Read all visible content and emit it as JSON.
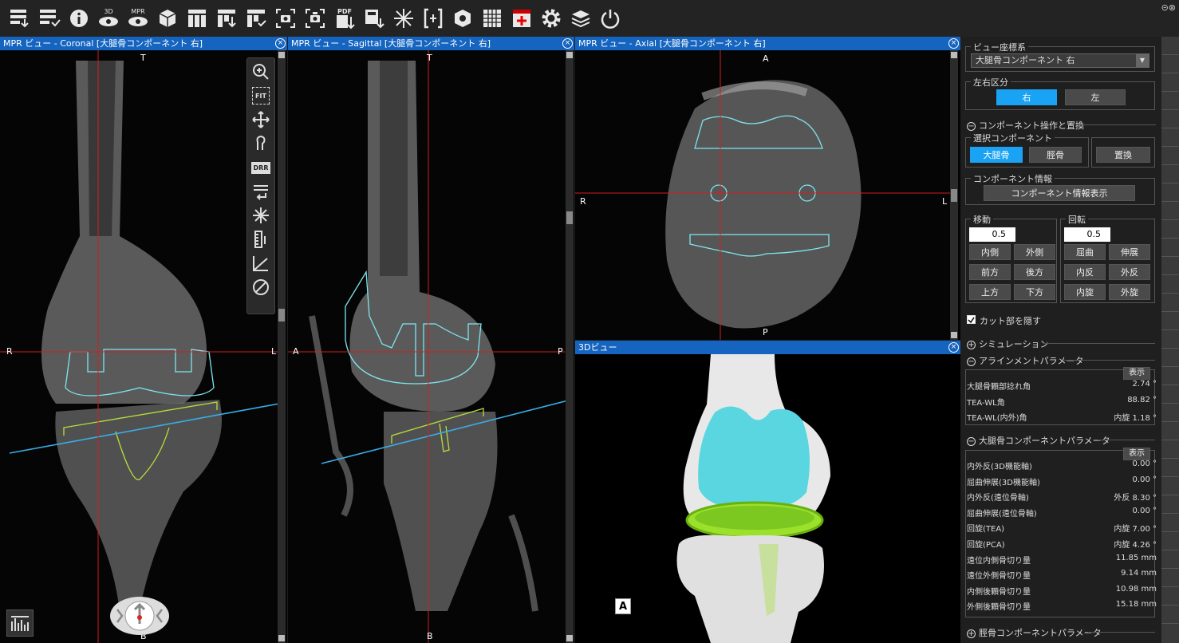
{
  "window": {
    "controls": "⊝⊗"
  },
  "toolbar": {
    "icons": [
      "load-case-icon",
      "save-case-icon",
      "info-icon",
      "3d-view-icon",
      "mpr-view-icon",
      "implant-cube-icon",
      "layout-icon",
      "export-layout-icon",
      "save-layout-icon",
      "screenshot-icon",
      "screenshot-all-icon",
      "pdf-export-icon",
      "snapshot-icon",
      "crosshair-icon",
      "bracket-icon",
      "component-icon",
      "grid-icon",
      "marker-icon",
      "settings-icon",
      "layers-icon",
      "power-icon"
    ],
    "labels": {
      "3d": "3D",
      "mpr": "MPR",
      "pdf": "PDF"
    }
  },
  "views": {
    "coronal": {
      "title": "MPR ビュー - Coronal [大腿骨コンポーネント 右]",
      "top": "T",
      "bottom": "B",
      "left": "R",
      "right": "L"
    },
    "sagittal": {
      "title": "MPR ビュー - Sagittal [大腿骨コンポーネント 右]",
      "top": "T",
      "bottom": "B",
      "left": "A",
      "right": "P"
    },
    "axial": {
      "title": "MPR ビュー - Axial [大腿骨コンポーネント 右]",
      "top": "A",
      "bottom": "P",
      "left": "R",
      "right": "L"
    },
    "v3d": {
      "title": "3Dビュー",
      "orient": "A"
    }
  },
  "viewtools": {
    "fit": "FIT",
    "drr": "DRR"
  },
  "panel": {
    "coord_title": "ビュー座標系",
    "coord_value": "大腿骨コンポーネント 右",
    "side_title": "左右区分",
    "side_right": "右",
    "side_left": "左",
    "comp_section": "コンポーネント操作と置換",
    "sel_title": "選択コンポーネント",
    "femur": "大腿骨",
    "tibia": "脛骨",
    "replace": "置換",
    "info_title": "コンポーネント情報",
    "info_btn": "コンポーネント情報表示",
    "move_title": "移動",
    "rot_title": "回転",
    "move_val": "0.5",
    "rot_val": "0.5",
    "move_btns": [
      "内側",
      "外側",
      "前方",
      "後方",
      "上方",
      "下方"
    ],
    "rot_btns": [
      "屈曲",
      "伸展",
      "内反",
      "外反",
      "内旋",
      "外旋"
    ],
    "hide_cut": "カット部を隠す",
    "simulation": "シミュレーション",
    "align_title": "アラインメントパラメータ",
    "show": "表示",
    "align_rows": [
      {
        "k": "大腿骨顆部捻れ角",
        "v": "2.74 °"
      },
      {
        "k": "TEA-WL角",
        "v": "88.82 °"
      },
      {
        "k": "TEA-WL(内外)角",
        "v": "内旋 1.18 °"
      }
    ],
    "femcomp_title": "大腿骨コンポーネントパラメータ",
    "fem_rows": [
      {
        "k": "内外反(3D機能軸)",
        "v": "0.00 °"
      },
      {
        "k": "屈曲伸展(3D機能軸)",
        "v": "0.00 °"
      },
      {
        "k": "内外反(遠位骨軸)",
        "v": "外反 8.30 °"
      },
      {
        "k": "屈曲伸展(遠位骨軸)",
        "v": "0.00 °"
      },
      {
        "k": "回旋(TEA)",
        "v": "内旋 7.00 °"
      },
      {
        "k": "回旋(PCA)",
        "v": "内旋 4.26 °"
      },
      {
        "k": "遠位内側骨切り量",
        "v": "11.85 mm"
      },
      {
        "k": "遠位外側骨切り量",
        "v": "9.14 mm"
      },
      {
        "k": "内側後顆骨切り量",
        "v": "10.98 mm"
      },
      {
        "k": "外側後顆骨切り量",
        "v": "15.18 mm"
      }
    ],
    "tibcomp_title": "脛骨コンポーネントパラメータ"
  }
}
